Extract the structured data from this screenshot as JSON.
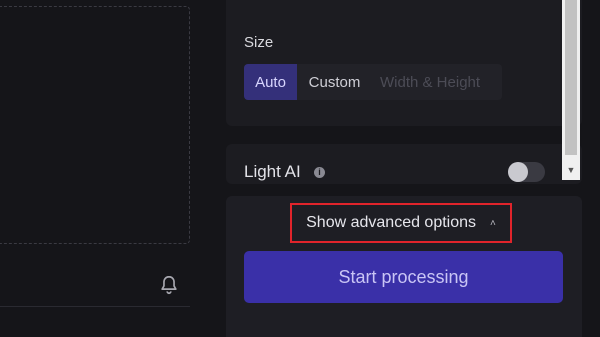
{
  "size": {
    "label": "Size",
    "options": [
      "Auto",
      "Custom",
      "Width & Height"
    ],
    "selected": "Auto"
  },
  "light_ai": {
    "label": "Light AI",
    "info_icon": "info-icon",
    "enabled": false
  },
  "advanced": {
    "label": "Show advanced options",
    "chevron": "˄"
  },
  "actions": {
    "start_label": "Start processing"
  },
  "colors": {
    "accent": "#3a30a8",
    "highlight_border": "#e0242b",
    "background": "#151519"
  }
}
